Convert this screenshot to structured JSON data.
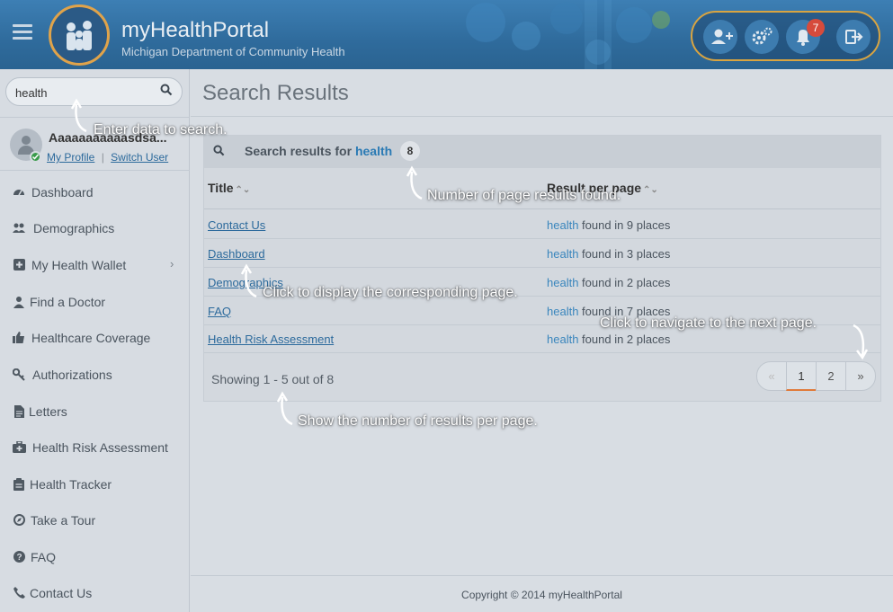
{
  "header": {
    "brand_title": "myHealthPortal",
    "brand_subtitle": "Michigan Department of Community Health",
    "notification_count": "7",
    "icons": [
      "add-user-icon",
      "settings-icon",
      "bell-icon",
      "logout-icon"
    ]
  },
  "sidebar": {
    "search": {
      "value": "health",
      "placeholder": ""
    },
    "profile": {
      "name": "Aaaaaaaaaaasdsa...",
      "my_profile": "My Profile",
      "separator": "|",
      "switch_user": "Switch User"
    },
    "items": [
      {
        "label": "Dashboard",
        "icon": "dashboard-icon"
      },
      {
        "label": "Demographics",
        "icon": "users-icon"
      },
      {
        "label": "My Health Wallet",
        "icon": "plus-square-icon",
        "has_submenu": true
      },
      {
        "label": "Find a Doctor",
        "icon": "doctor-icon"
      },
      {
        "label": "Healthcare Coverage",
        "icon": "thumbs-up-icon"
      },
      {
        "label": "Authorizations",
        "icon": "key-icon"
      },
      {
        "label": "Letters",
        "icon": "document-icon"
      },
      {
        "label": "Health Risk Assessment",
        "icon": "medkit-icon"
      },
      {
        "label": "Health Tracker",
        "icon": "clipboard-icon"
      },
      {
        "label": "Take a Tour",
        "icon": "compass-icon"
      },
      {
        "label": "FAQ",
        "icon": "question-icon"
      },
      {
        "label": "Contact Us",
        "icon": "phone-icon"
      }
    ]
  },
  "main": {
    "title": "Search Results",
    "results_prefix": "Search results for",
    "search_term": "health",
    "results_count": "8",
    "columns": {
      "title": "Title",
      "result": "Result per page"
    },
    "rows": [
      {
        "title": "Contact Us",
        "term": "health",
        "found": "found in 9 places"
      },
      {
        "title": "Dashboard",
        "term": "health",
        "found": "found in 3 places"
      },
      {
        "title": "Demographics",
        "term": "health",
        "found": "found in 2 places"
      },
      {
        "title": "FAQ",
        "term": "health",
        "found": "found in 7 places"
      },
      {
        "title": "Health Risk Assessment",
        "term": "health",
        "found": "found in 2 places"
      }
    ],
    "showing": "Showing 1 - 5 out of 8",
    "pagination": {
      "prev": "«",
      "pages": [
        "1",
        "2"
      ],
      "next": "»",
      "active_page": "1"
    }
  },
  "footer": {
    "copyright": "Copyright © 2014 myHealthPortal"
  },
  "annotations": {
    "search": "Enter data to search.",
    "count": "Number of page results found.",
    "link": "Click to display the corresponding page.",
    "next": "Click to navigate to the next page.",
    "showing": "Show the number of results per page."
  },
  "colors": {
    "header": "#2f6b9c",
    "accent_gold": "#d9a441",
    "link": "#2c6a9c",
    "badge": "#d64b3c"
  }
}
